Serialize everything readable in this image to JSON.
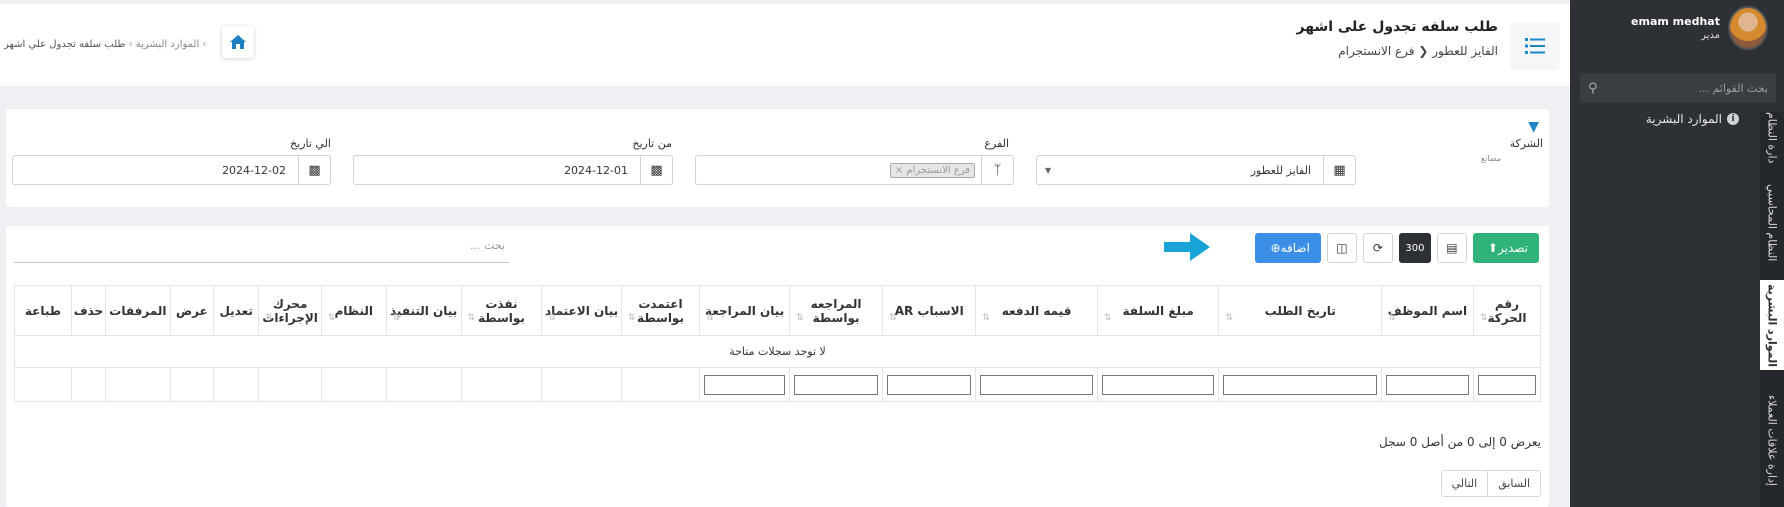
{
  "sidebar": {
    "user_name": "emam medhat",
    "user_role": "مدير",
    "search_placeholder": "بحث القوائم ...",
    "menu_item": "الموارد البشرية",
    "vtabs": [
      "دارة النظام",
      "النظام المحاسبي",
      "الموارد البشرية",
      "إدارة علاقات العملاء"
    ]
  },
  "header": {
    "title": "طلب سلفه تجدول على اشهر",
    "crumb_company": "الفايز للعطور",
    "crumb_branch": "فرع الانستجرام",
    "breadcrumb_hr": "الموارد البشرية",
    "breadcrumb_page": "طلب سلفه تجدول علي اشهر"
  },
  "filters": {
    "company_label": "الشركة",
    "company_hint": "مصانع",
    "company_value": "الفايز للعطور",
    "branch_label": "الفرع",
    "branch_tag": "فرع الانستجرام",
    "from_label": "من تاريخ",
    "from_value": "2024-12-01",
    "to_label": "الي تاريخ",
    "to_value": "2024-12-02"
  },
  "toolbar": {
    "export_label": "تصدير",
    "page_size": "300",
    "add_label": "اضافه",
    "search_placeholder": "بحث ..."
  },
  "table": {
    "columns": [
      "رقم الحركة",
      "اسم الموظف",
      "تاريخ الطلب",
      "مبلغ السلفة",
      "قيمه الدفعه",
      "الاسباب AR",
      "المراجعه بواسطة",
      "بيان المراجعة",
      "اعتمدت بواسطة",
      "بيان الاعتماد",
      "نفذت بواسطة",
      "بيان التنفيذ",
      "النظام",
      "محرك الإجراءات",
      "تعديل",
      "عرض",
      "المرفقات",
      "حذف",
      "طباعة"
    ],
    "empty_text": "لا توجد سجلات متاحة"
  },
  "footer": {
    "info": "يعرض 0 إلى 0 من أصل 0 سجل",
    "prev": "السابق",
    "next": "التالي"
  },
  "colors": {
    "accent": "#1e88c7",
    "sidebar": "#2d3035",
    "export": "#2fb37a",
    "add": "#3b8fe6"
  }
}
